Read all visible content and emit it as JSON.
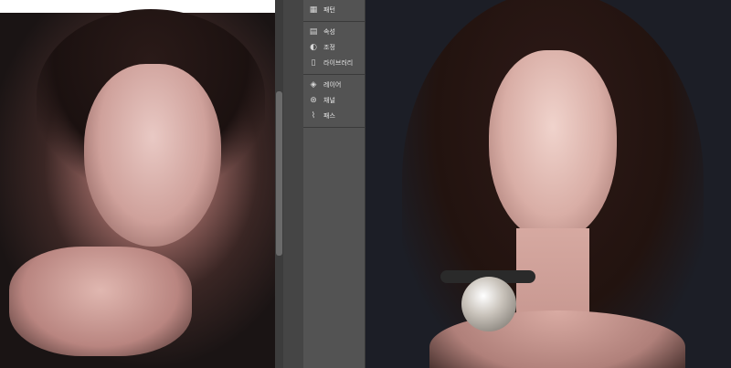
{
  "panel": {
    "groups": [
      {
        "items": [
          {
            "label": "패턴",
            "icon": "grid-icon"
          }
        ]
      },
      {
        "items": [
          {
            "label": "속성",
            "icon": "properties-icon"
          },
          {
            "label": "조정",
            "icon": "adjustments-icon"
          },
          {
            "label": "라이브러리",
            "icon": "library-icon"
          }
        ]
      },
      {
        "items": [
          {
            "label": "레이어",
            "icon": "layers-icon"
          },
          {
            "label": "채널",
            "icon": "channels-icon"
          },
          {
            "label": "패스",
            "icon": "paths-icon"
          }
        ]
      }
    ]
  }
}
